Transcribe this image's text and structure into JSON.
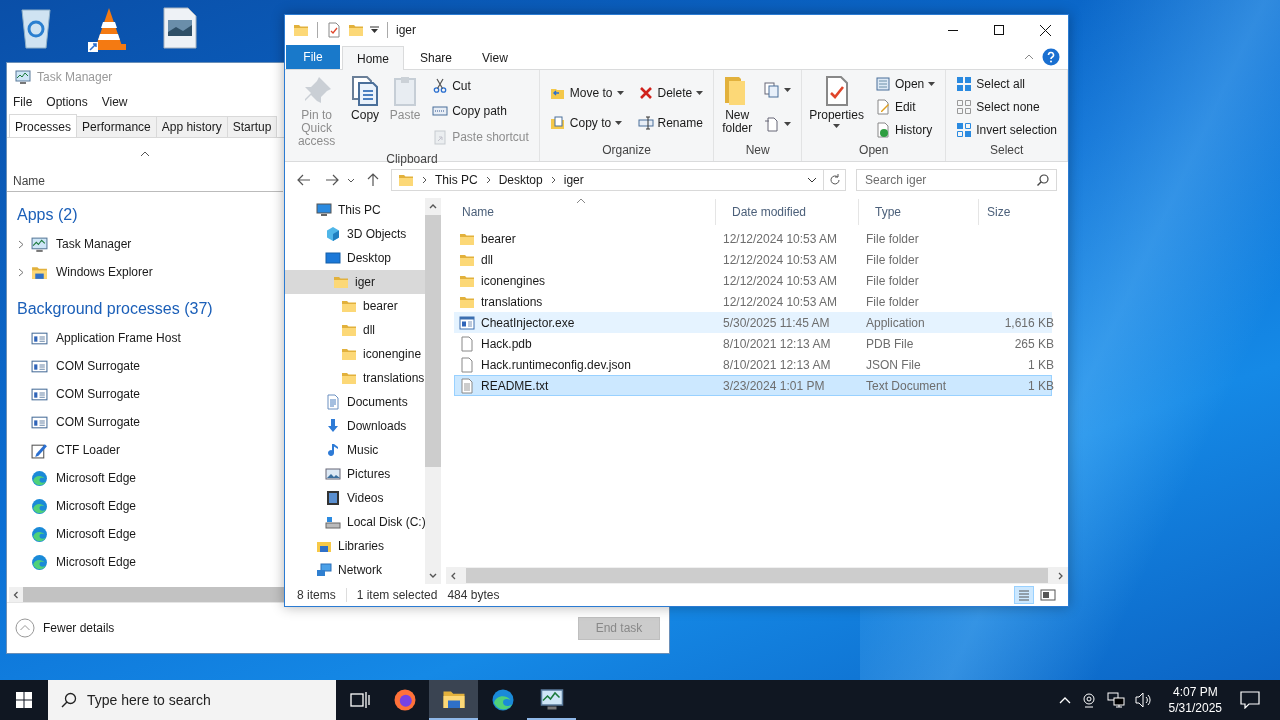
{
  "task_manager": {
    "title": "Task Manager",
    "menu": [
      "File",
      "Options",
      "View"
    ],
    "tabs": [
      {
        "label": "Processes",
        "selected": true
      },
      {
        "label": "Performance",
        "selected": false
      },
      {
        "label": "App history",
        "selected": false
      },
      {
        "label": "Startup",
        "selected": false
      }
    ],
    "column": "Name",
    "groups": [
      {
        "title": "Apps (2)",
        "items": [
          {
            "name": "Task Manager",
            "kind": "taskmgr",
            "expandable": true
          },
          {
            "name": "Windows Explorer",
            "kind": "explorerapp",
            "expandable": true
          }
        ]
      },
      {
        "title": "Background processes (37)",
        "items": [
          {
            "name": "Application Frame Host",
            "kind": "com",
            "expandable": false
          },
          {
            "name": "COM Surrogate",
            "kind": "com",
            "expandable": false
          },
          {
            "name": "COM Surrogate",
            "kind": "com",
            "expandable": false
          },
          {
            "name": "COM Surrogate",
            "kind": "com",
            "expandable": false
          },
          {
            "name": "CTF Loader",
            "kind": "ctf",
            "expandable": false
          },
          {
            "name": "Microsoft Edge",
            "kind": "edge",
            "expandable": false
          },
          {
            "name": "Microsoft Edge",
            "kind": "edge",
            "expandable": false
          },
          {
            "name": "Microsoft Edge",
            "kind": "edge",
            "expandable": false
          },
          {
            "name": "Microsoft Edge",
            "kind": "edge",
            "expandable": false
          }
        ]
      }
    ],
    "fewer_details": "Fewer details",
    "end_task": {
      "label": "End task",
      "disabled": true
    }
  },
  "explorer": {
    "title": "iger",
    "file_tab": "File",
    "tabs": [
      {
        "label": "Home",
        "selected": true
      },
      {
        "label": "Share",
        "selected": false
      },
      {
        "label": "View",
        "selected": false
      }
    ],
    "groups": [
      {
        "label": "Clipboard",
        "columns": [
          [
            {
              "label": "Pin to Quick access",
              "kind": "pin",
              "large": true,
              "disabled": true,
              "dropdown": false
            }
          ],
          [
            {
              "label": "Copy",
              "kind": "copy",
              "large": true,
              "disabled": false,
              "dropdown": false
            }
          ],
          [
            {
              "label": "Paste",
              "kind": "paste",
              "large": true,
              "disabled": true,
              "dropdown": false
            }
          ],
          [
            {
              "label": "Cut",
              "kind": "cut",
              "large": false,
              "disabled": false,
              "dropdown": false
            },
            {
              "label": "Copy path",
              "kind": "copypath",
              "large": false,
              "disabled": false,
              "dropdown": false
            },
            {
              "label": "Paste shortcut",
              "kind": "pasteshortcut",
              "large": false,
              "disabled": true,
              "dropdown": false
            }
          ]
        ]
      },
      {
        "label": "Organize",
        "columns": [
          [
            {
              "label": "Move to",
              "kind": "move",
              "large": false,
              "disabled": false,
              "dropdown": true
            },
            {
              "label": "Copy to",
              "kind": "copyto",
              "large": false,
              "disabled": false,
              "dropdown": true
            }
          ],
          [
            {
              "label": "Delete",
              "kind": "delete",
              "large": false,
              "disabled": false,
              "dropdown": true
            },
            {
              "label": "Rename",
              "kind": "rename",
              "large": false,
              "disabled": false,
              "dropdown": false
            }
          ]
        ]
      },
      {
        "label": "New",
        "columns": [
          [
            {
              "label": "New folder",
              "kind": "newfolder",
              "large": true,
              "disabled": false,
              "dropdown": false
            }
          ],
          [
            {
              "kind": "newitem",
              "large": false,
              "disabled": false,
              "dropdown": true
            },
            {
              "kind": "easyaccess",
              "large": false,
              "disabled": false,
              "dropdown": true
            }
          ]
        ]
      },
      {
        "label": "Open",
        "columns": [
          [
            {
              "label": "Properties",
              "kind": "properties",
              "large": true,
              "disabled": false,
              "dropdown": true
            }
          ],
          [
            {
              "label": "Open",
              "kind": "open",
              "large": false,
              "disabled": false,
              "dropdown": true
            },
            {
              "label": "Edit",
              "kind": "edit",
              "large": false,
              "disabled": false,
              "dropdown": false
            },
            {
              "label": "History",
              "kind": "history",
              "large": false,
              "disabled": false,
              "dropdown": false
            }
          ]
        ]
      },
      {
        "label": "Select",
        "columns": [
          [
            {
              "label": "Select all",
              "kind": "selectall",
              "large": false,
              "disabled": false,
              "dropdown": false
            },
            {
              "label": "Select none",
              "kind": "selectnone",
              "large": false,
              "disabled": false,
              "dropdown": false
            },
            {
              "label": "Invert selection",
              "kind": "invert",
              "large": false,
              "disabled": false,
              "dropdown": false
            }
          ]
        ]
      }
    ],
    "path": [
      "This PC",
      "Desktop",
      "iger"
    ],
    "search": {
      "placeholder": "Search iger"
    },
    "nav": [
      {
        "label": "This PC",
        "kind": "thispc",
        "selected": false,
        "children": [
          {
            "label": "3D Objects",
            "kind": "objects3d",
            "selected": false
          },
          {
            "label": "Desktop",
            "kind": "desktop",
            "selected": false,
            "children": [
              {
                "label": "iger",
                "kind": "folder",
                "selected": true,
                "children": [
                  {
                    "label": "bearer",
                    "kind": "folder",
                    "selected": false
                  },
                  {
                    "label": "dll",
                    "kind": "folder",
                    "selected": false
                  },
                  {
                    "label": "iconengine",
                    "kind": "folder",
                    "selected": false
                  },
                  {
                    "label": "translations",
                    "kind": "folder",
                    "selected": false
                  }
                ]
              }
            ]
          },
          {
            "label": "Documents",
            "kind": "documents",
            "selected": false
          },
          {
            "label": "Downloads",
            "kind": "downloads",
            "selected": false
          },
          {
            "label": "Music",
            "kind": "music",
            "selected": false
          },
          {
            "label": "Pictures",
            "kind": "pictures",
            "selected": false
          },
          {
            "label": "Videos",
            "kind": "videos",
            "selected": false
          },
          {
            "label": "Local Disk (C:)",
            "kind": "disk",
            "selected": false
          }
        ]
      },
      {
        "label": "Libraries",
        "kind": "libraries",
        "selected": false
      },
      {
        "label": "Network",
        "kind": "network",
        "selected": false
      }
    ],
    "columns": [
      "Name",
      "Date modified",
      "Type",
      "Size"
    ],
    "files": [
      {
        "name": "bearer",
        "kind": "folder",
        "date": "12/12/2024 10:53 AM",
        "type": "File folder",
        "selected": false,
        "hovered": false
      },
      {
        "name": "dll",
        "kind": "folder",
        "date": "12/12/2024 10:53 AM",
        "type": "File folder",
        "selected": false,
        "hovered": false
      },
      {
        "name": "iconengines",
        "kind": "folder",
        "date": "12/12/2024 10:53 AM",
        "type": "File folder",
        "selected": false,
        "hovered": false
      },
      {
        "name": "translations",
        "kind": "folder",
        "date": "12/12/2024 10:53 AM",
        "type": "File folder",
        "selected": false,
        "hovered": false
      },
      {
        "name": "CheatInjector.exe",
        "kind": "exe",
        "date": "5/30/2025 11:45 AM",
        "type": "Application",
        "size": "1,616 KB",
        "selected": false,
        "hovered": true
      },
      {
        "name": "Hack.pdb",
        "kind": "file",
        "date": "8/10/2021 12:13 AM",
        "type": "PDB File",
        "size": "265 KB",
        "selected": false,
        "hovered": false
      },
      {
        "name": "Hack.runtimeconfig.dev.json",
        "kind": "file",
        "date": "8/10/2021 12:13 AM",
        "type": "JSON File",
        "size": "1 KB",
        "selected": false,
        "hovered": false
      },
      {
        "name": "README.txt",
        "kind": "txt",
        "date": "3/23/2024 1:01 PM",
        "type": "Text Document",
        "size": "1 KB",
        "selected": true,
        "hovered": false
      }
    ],
    "status": {
      "items": "8 items",
      "selection": "1 item selected",
      "bytes": "484 bytes"
    }
  },
  "taskbar": {
    "search": {
      "placeholder": "Type here to search"
    },
    "apps": [
      {
        "kind": "firefox",
        "open": false,
        "focused": false
      },
      {
        "kind": "explorerapp",
        "open": true,
        "focused": true
      },
      {
        "kind": "edge",
        "open": false,
        "focused": false
      },
      {
        "kind": "taskmgr",
        "open": true,
        "focused": false
      }
    ],
    "time": "4:07 PM",
    "date": "5/31/2025"
  }
}
